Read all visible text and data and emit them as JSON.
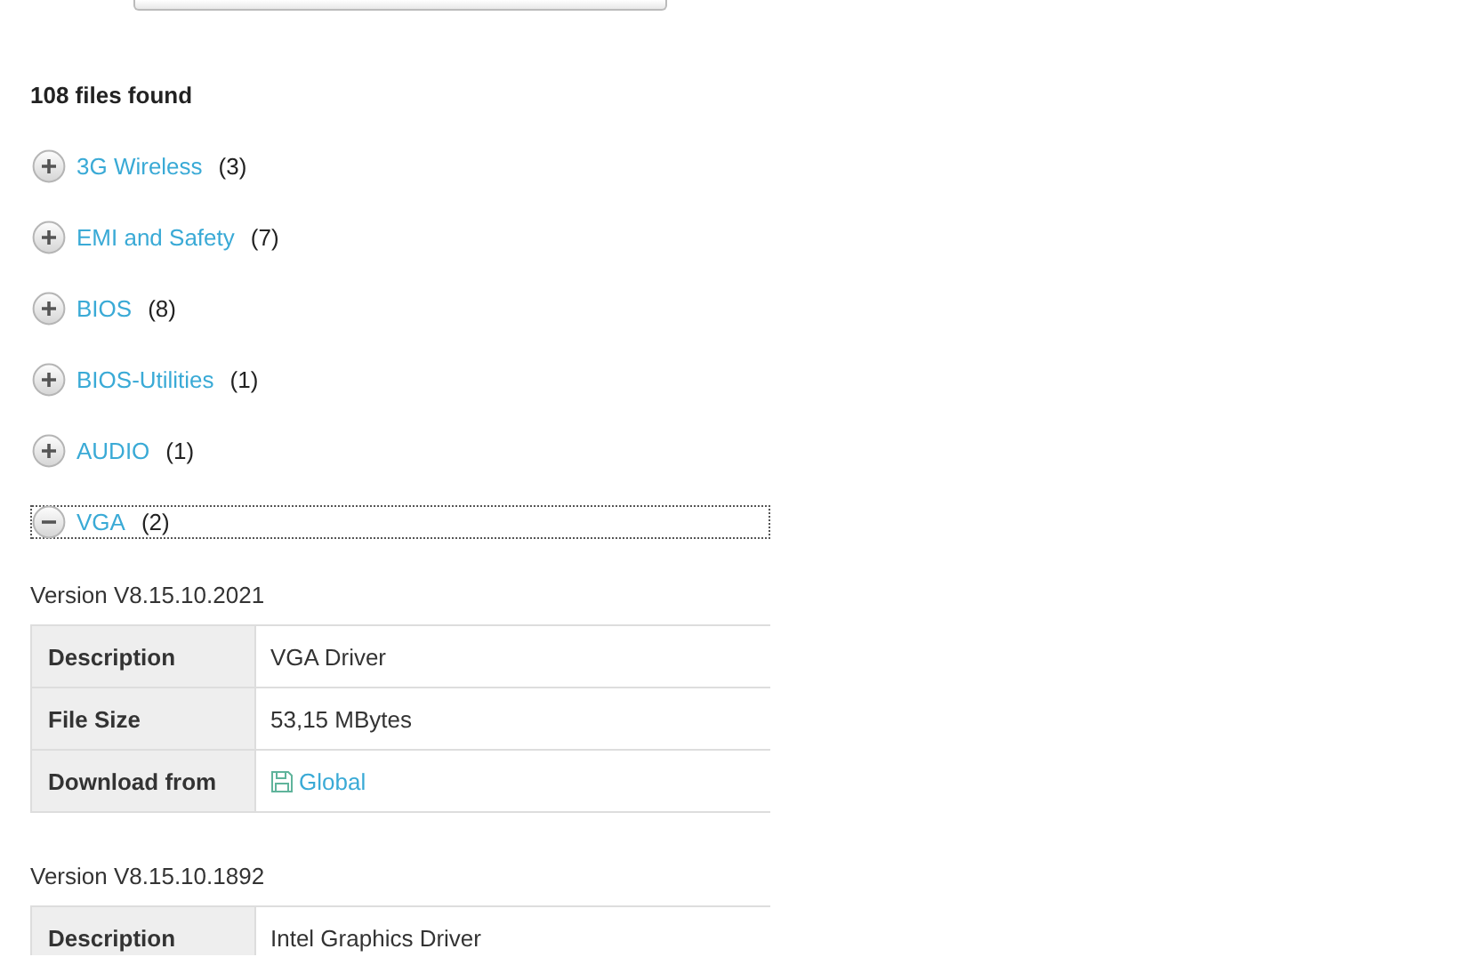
{
  "result_count": "108 files found",
  "categories": [
    {
      "name": "3G Wireless",
      "count": "(3)",
      "expanded": false,
      "focused": false
    },
    {
      "name": "EMI and Safety",
      "count": "(7)",
      "expanded": false,
      "focused": false
    },
    {
      "name": "BIOS",
      "count": "(8)",
      "expanded": false,
      "focused": false
    },
    {
      "name": "BIOS-Utilities",
      "count": "(1)",
      "expanded": false,
      "focused": false
    },
    {
      "name": "AUDIO",
      "count": "(1)",
      "expanded": false,
      "focused": false
    },
    {
      "name": "VGA",
      "count": "(2)",
      "expanded": true,
      "focused": true,
      "versions": [
        {
          "title": "Version V8.15.10.2021",
          "rows": [
            {
              "kind": "text",
              "label": "Description",
              "value": "VGA Driver"
            },
            {
              "kind": "text",
              "label": "File Size",
              "value": "53,15 MBytes"
            },
            {
              "kind": "download",
              "label": "Download from",
              "value": "Global"
            }
          ]
        },
        {
          "title": "Version V8.15.10.1892",
          "rows": [
            {
              "kind": "text",
              "label": "Description",
              "value": "Intel Graphics Driver"
            }
          ]
        }
      ]
    }
  ]
}
